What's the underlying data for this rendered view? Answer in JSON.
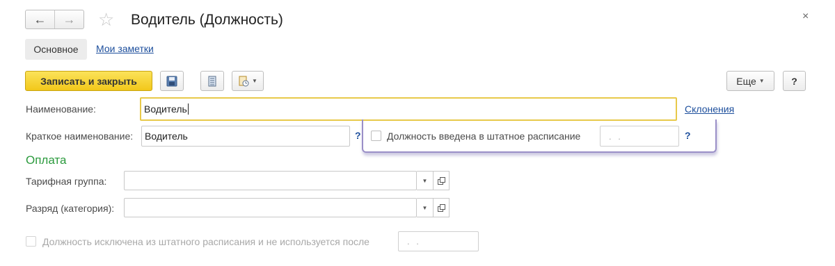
{
  "header": {
    "back_icon": "←",
    "forward_icon": "→",
    "favorite_icon": "☆",
    "title": "Водитель (Должность)",
    "close_icon": "×"
  },
  "tabs": [
    {
      "label": "Основное",
      "active": true
    },
    {
      "label": "Мои заметки",
      "active": false
    }
  ],
  "toolbar": {
    "save_close_label": "Записать и закрыть",
    "more_label": "Еще",
    "help_label": "?"
  },
  "form": {
    "name_label": "Наименование:",
    "name_value": "Водитель",
    "declensions_link": "Склонения",
    "short_name_label": "Краткое наименование:",
    "short_name_value": "Водитель",
    "short_name_help": "?",
    "staff_checkbox_label": "Должность введена в штатное расписание",
    "staff_date_placeholder": ". .",
    "staff_help": "?",
    "payment_section": "Оплата",
    "tariff_group_label": "Тарифная группа:",
    "tariff_group_value": "",
    "rank_label": "Разряд (категория):",
    "rank_value": "",
    "excluded_checkbox_label": "Должность исключена из штатного расписания и не используется после",
    "excluded_date_placeholder": ". ."
  },
  "colors": {
    "accent_yellow": "#f2c81a",
    "link_blue": "#1c4e9c",
    "section_green": "#2b9a3d",
    "highlight_purple": "#9a8fc7"
  }
}
